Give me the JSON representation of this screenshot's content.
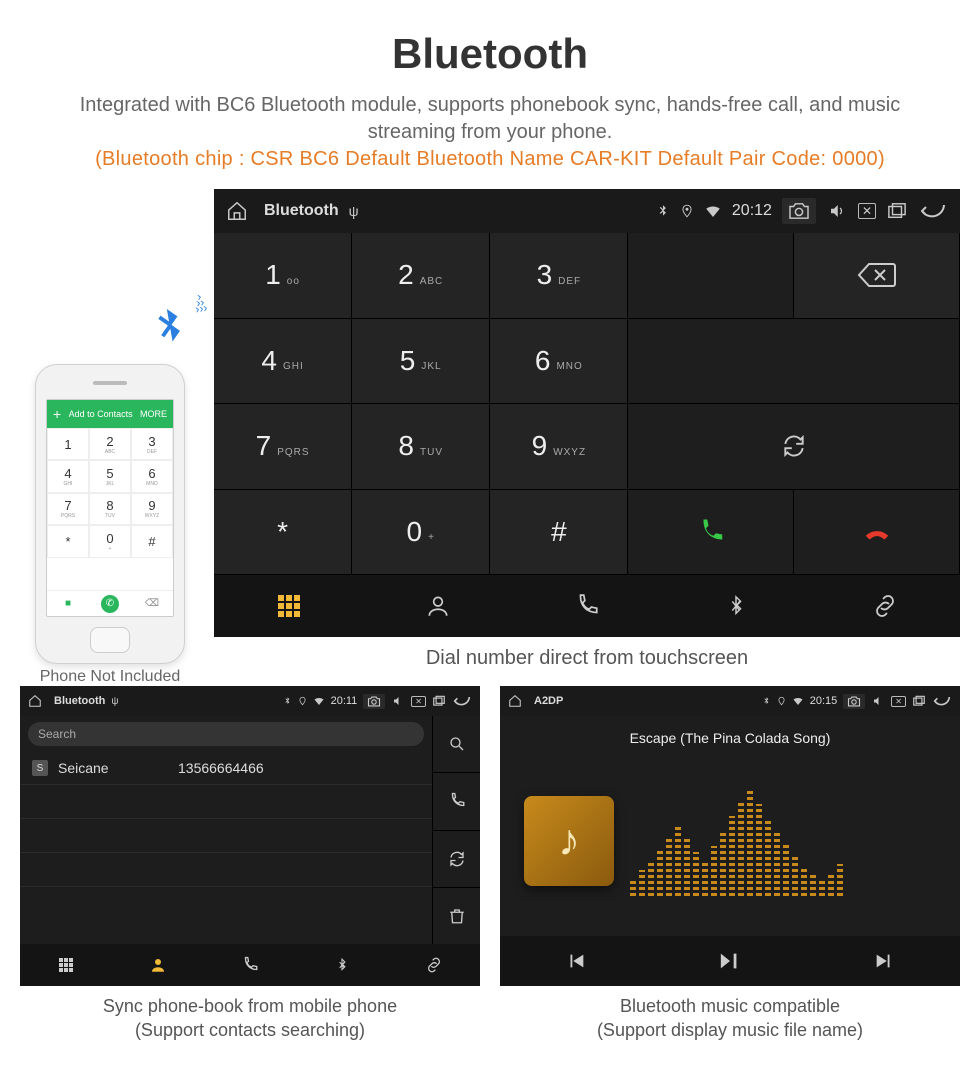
{
  "header": {
    "title": "Bluetooth",
    "desc": "Integrated with BC6 Bluetooth module, supports phonebook sync, hands-free call, and music streaming from your phone.",
    "note": "(Bluetooth chip : CSR BC6    Default Bluetooth Name CAR-KIT    Default Pair Code: 0000)"
  },
  "phone": {
    "caption": "Phone Not Included",
    "header_label": "Add to Contacts",
    "header_more": "MORE",
    "keys": [
      {
        "n": "1",
        "s": ""
      },
      {
        "n": "2",
        "s": "ABC"
      },
      {
        "n": "3",
        "s": "DEF"
      },
      {
        "n": "4",
        "s": "GHI"
      },
      {
        "n": "5",
        "s": "JKL"
      },
      {
        "n": "6",
        "s": "MNO"
      },
      {
        "n": "7",
        "s": "PQRS"
      },
      {
        "n": "8",
        "s": "TUV"
      },
      {
        "n": "9",
        "s": "WXYZ"
      },
      {
        "n": "*",
        "s": ""
      },
      {
        "n": "0",
        "s": "+"
      },
      {
        "n": "#",
        "s": ""
      }
    ]
  },
  "dialer": {
    "status": {
      "title": "Bluetooth",
      "time": "20:12"
    },
    "keys": [
      {
        "n": "1",
        "s": "oo"
      },
      {
        "n": "2",
        "s": "ABC"
      },
      {
        "n": "3",
        "s": "DEF"
      },
      {
        "n": "4",
        "s": "GHI"
      },
      {
        "n": "5",
        "s": "JKL"
      },
      {
        "n": "6",
        "s": "MNO"
      },
      {
        "n": "7",
        "s": "PQRS"
      },
      {
        "n": "8",
        "s": "TUV"
      },
      {
        "n": "9",
        "s": "WXYZ"
      },
      {
        "n": "*",
        "s": ""
      },
      {
        "n": "0",
        "s": "+"
      },
      {
        "n": "#",
        "s": ""
      }
    ],
    "caption": "Dial number direct from touchscreen"
  },
  "contacts": {
    "status": {
      "title": "Bluetooth",
      "time": "20:11"
    },
    "search_placeholder": "Search",
    "row": {
      "badge": "S",
      "name": "Seicane",
      "number": "13566664466"
    },
    "caption_line1": "Sync phone-book from mobile phone",
    "caption_line2": "(Support contacts searching)"
  },
  "a2dp": {
    "status": {
      "title": "A2DP",
      "time": "20:15"
    },
    "song": "Escape (The Pina Colada Song)",
    "eq_heights": [
      18,
      26,
      34,
      46,
      60,
      72,
      58,
      44,
      36,
      50,
      64,
      80,
      94,
      106,
      92,
      78,
      64,
      52,
      40,
      30,
      22,
      16,
      24,
      32
    ],
    "caption_line1": "Bluetooth music compatible",
    "caption_line2": "(Support display music file name)"
  },
  "icons": {
    "bluetooth": "฿",
    "home": "home"
  }
}
